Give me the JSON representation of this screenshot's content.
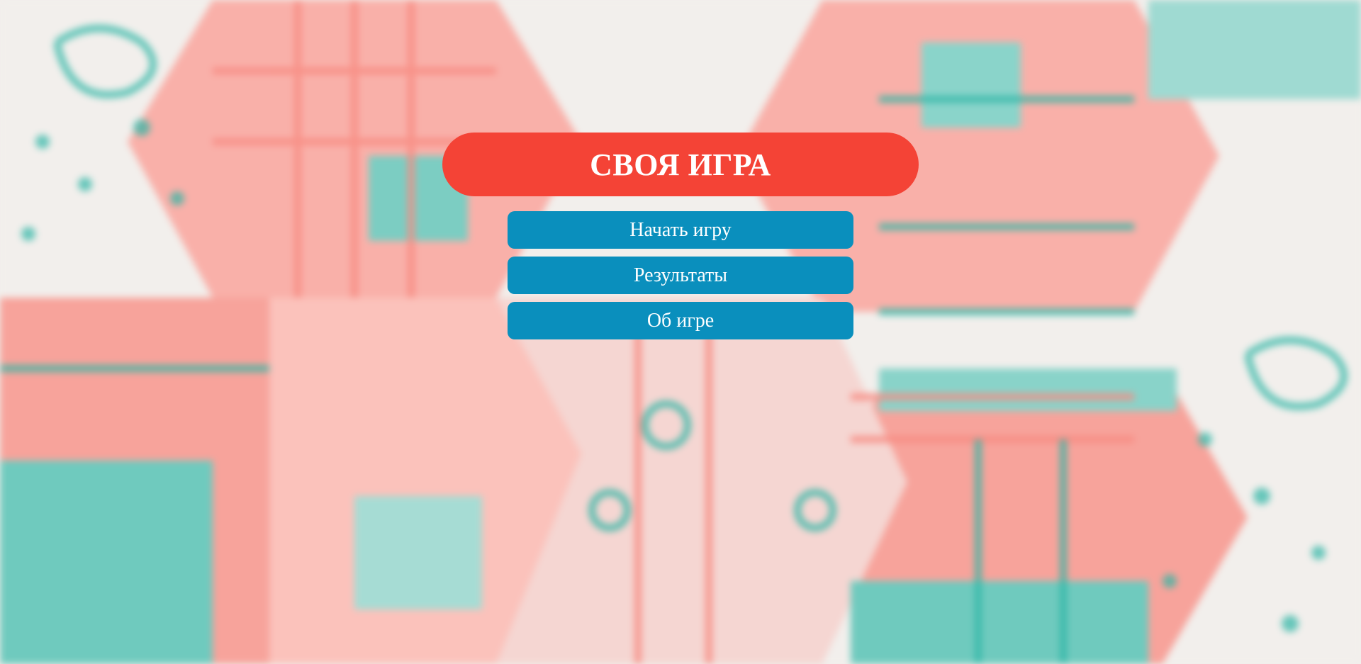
{
  "app": {
    "title": "СВОЯ ИГРА"
  },
  "menu": {
    "items": [
      {
        "label": "Начать игру"
      },
      {
        "label": "Результаты"
      },
      {
        "label": "Об игре"
      }
    ]
  },
  "colors": {
    "title_bg": "#f44336",
    "button_bg": "#0a8fbd",
    "text": "#ffffff",
    "bg_coral": "#f88b82",
    "bg_teal": "#2cb5a5",
    "bg_base": "#f2efec"
  }
}
